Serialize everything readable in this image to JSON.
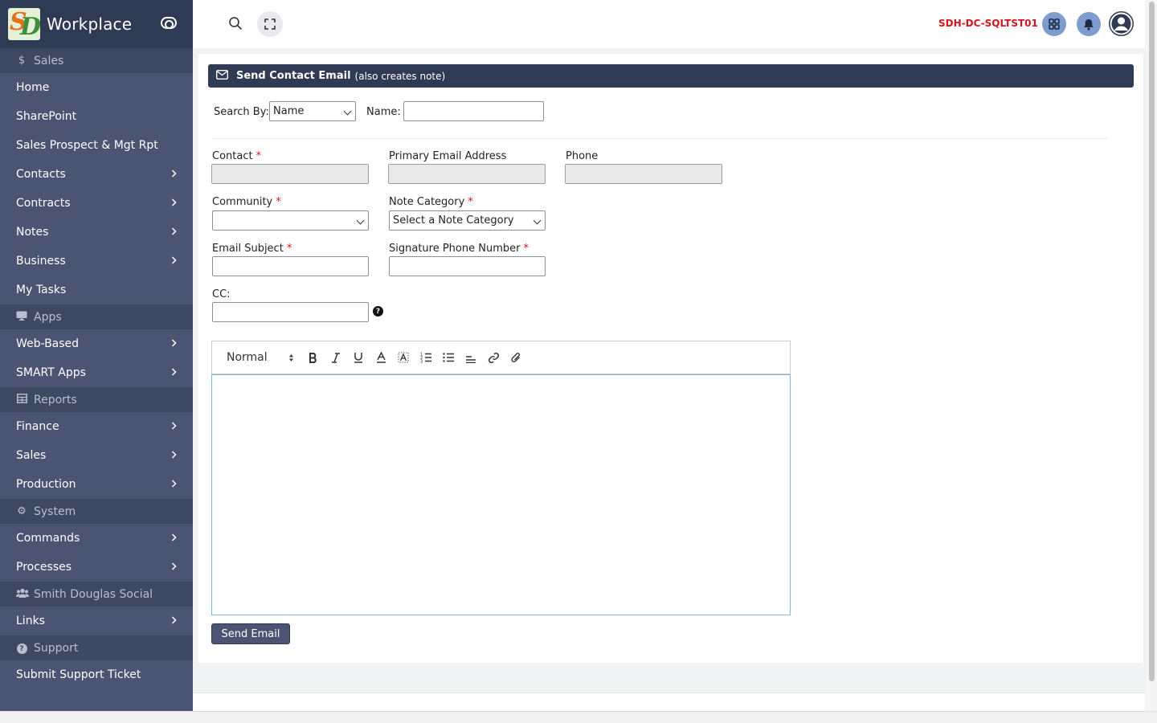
{
  "app": {
    "name": "Workplace"
  },
  "sidebar": {
    "sections": [
      {
        "label": "Sales",
        "icon": "dollar-icon",
        "items": [
          {
            "label": "Home",
            "has_children": false
          },
          {
            "label": "SharePoint",
            "has_children": false
          },
          {
            "label": "Sales Prospect & Mgt Rpt",
            "has_children": false
          },
          {
            "label": "Contacts",
            "has_children": true
          },
          {
            "label": "Contracts",
            "has_children": true
          },
          {
            "label": "Notes",
            "has_children": true
          },
          {
            "label": "Business",
            "has_children": true
          },
          {
            "label": "My Tasks",
            "has_children": false
          }
        ]
      },
      {
        "label": "Apps",
        "icon": "monitor-icon",
        "items": [
          {
            "label": "Web-Based",
            "has_children": true
          },
          {
            "label": "SMART Apps",
            "has_children": true
          }
        ]
      },
      {
        "label": "Reports",
        "icon": "table-icon",
        "items": [
          {
            "label": "Finance",
            "has_children": true
          },
          {
            "label": "Sales",
            "has_children": true
          },
          {
            "label": "Production",
            "has_children": true
          }
        ]
      },
      {
        "label": "System",
        "icon": "gear-icon",
        "items": [
          {
            "label": "Commands",
            "has_children": true
          },
          {
            "label": "Processes",
            "has_children": true
          }
        ]
      },
      {
        "label": "Smith Douglas Social",
        "icon": "users-icon",
        "items": [
          {
            "label": "Links",
            "has_children": true
          }
        ]
      },
      {
        "label": "Support",
        "icon": "question-circle-icon",
        "items": [
          {
            "label": "Submit Support Ticket",
            "has_children": false
          }
        ]
      }
    ]
  },
  "topbar": {
    "server_name": "SDH-DC-SQLTST01",
    "server_color": "#d6141c"
  },
  "form": {
    "header_title": "Send Contact Email",
    "header_subtitle": "(also creates note)",
    "search_by_label": "Search By:",
    "search_by_value": "Name",
    "name_label": "Name:",
    "name_value": "",
    "contact_label": "Contact",
    "contact_value": "",
    "primary_email_label": "Primary Email Address",
    "primary_email_value": "",
    "phone_label": "Phone",
    "phone_value": "",
    "community_label": "Community",
    "community_value": "",
    "note_category_label": "Note Category",
    "note_category_value": "Select a Note Category",
    "email_subject_label": "Email Subject",
    "email_subject_value": "",
    "signature_phone_label": "Signature Phone Number",
    "signature_phone_value": "",
    "cc_label": "CC:",
    "cc_value": "",
    "required_mark": "*",
    "help_glyph": "?",
    "editor_heading": "Normal",
    "send_button": "Send Email"
  },
  "colors": {
    "sidebar_bg": "#4b5573",
    "brand_bg": "#2f3a55",
    "section_bg": "#3f4863",
    "required": "#d6141c"
  }
}
